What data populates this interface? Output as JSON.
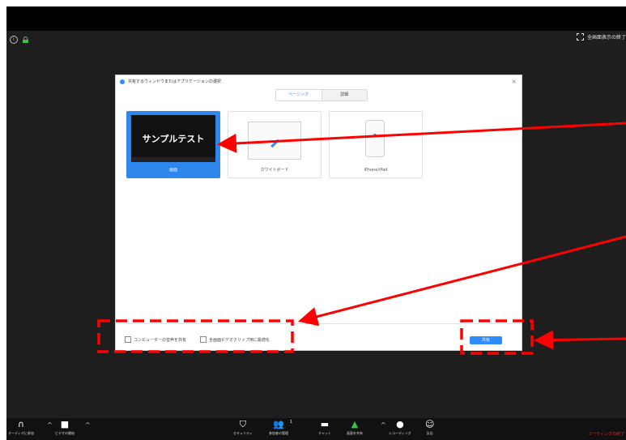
{
  "app": {
    "fullscreen_exit_label": "全画面表示の終了",
    "info_icon_glyph": "i"
  },
  "dialog": {
    "title": "共有するウィンドウまたはアプリケーションの選択",
    "close_glyph": "×",
    "tabs": [
      {
        "label": "ベーシック",
        "active": true
      },
      {
        "label": "詳細",
        "active": false
      }
    ],
    "tiles": [
      {
        "thumb_text": "サンプルテスト",
        "label": "画面",
        "selected": true
      },
      {
        "label": "ホワイトボード",
        "selected": false
      },
      {
        "label": "iPhone/iPad",
        "selected": false
      }
    ],
    "options": [
      {
        "label": "コンピューターの音声を共有",
        "checked": false
      },
      {
        "label": "全画面ビデオクリップ用に最適化",
        "checked": false
      }
    ],
    "share_button": "共有"
  },
  "toolbar": {
    "items": [
      {
        "icon": "headphones-icon",
        "glyph": "∩",
        "label": "オーディオに参加"
      },
      {
        "icon": "video-off-icon",
        "glyph": "■",
        "label": "ビデオの開始"
      },
      {
        "icon": "security-icon",
        "glyph": "⛉",
        "label": "セキュリティ"
      },
      {
        "icon": "participants-icon",
        "glyph": "👥",
        "label": "参加者の管理",
        "count": "1"
      },
      {
        "icon": "chat-icon",
        "glyph": "▬",
        "label": "チャット"
      },
      {
        "icon": "share-screen-icon",
        "glyph": "▲",
        "label": "画面を共有"
      },
      {
        "icon": "record-icon",
        "glyph": "●",
        "label": "レコーディング"
      },
      {
        "icon": "reactions-icon",
        "glyph": "☺",
        "label": "反応"
      }
    ],
    "caret_glyph": "^",
    "end_meeting": "ミーティングの終了"
  },
  "colors": {
    "accent": "#2d8cff",
    "annotation": "#ff0000",
    "end_meeting": "#e02828"
  }
}
